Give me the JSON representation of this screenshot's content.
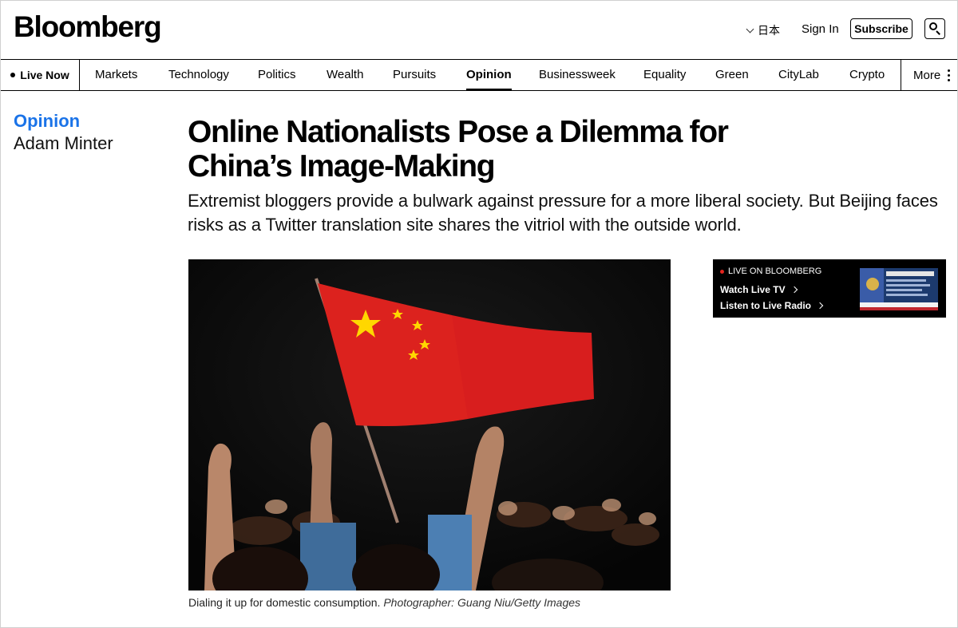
{
  "header": {
    "logo": "Bloomberg",
    "language": "日本",
    "sign_in": "Sign In",
    "subscribe": "Subscribe"
  },
  "nav": {
    "live_now": "Live Now",
    "items": [
      "Markets",
      "Technology",
      "Politics",
      "Wealth",
      "Pursuits",
      "Opinion",
      "Businessweek",
      "Equality",
      "Green",
      "CityLab",
      "Crypto"
    ],
    "active": "Opinion",
    "more": "More"
  },
  "article": {
    "section": "Opinion",
    "author": "Adam Minter",
    "headline": "Online Nationalists Pose a Dilemma for China’s Image-Making",
    "dek": "Extremist bloggers provide a bulwark against pressure for a more liberal society. But Beijing faces risks as a Twitter translation site shares the vitriol with the outside world.",
    "caption": "Dialing it up for domestic consumption.",
    "credit": "Photographer: Guang Niu/Getty Images"
  },
  "live_widget": {
    "label": "LIVE ON BLOOMBERG",
    "watch_tv": "Watch Live TV",
    "listen_radio": "Listen to Live Radio"
  },
  "colors": {
    "opinion_accent": "#1a73e8",
    "flag_red": "#d81e1e",
    "flag_star": "#ffd700",
    "live_dot": "#e5251e"
  }
}
